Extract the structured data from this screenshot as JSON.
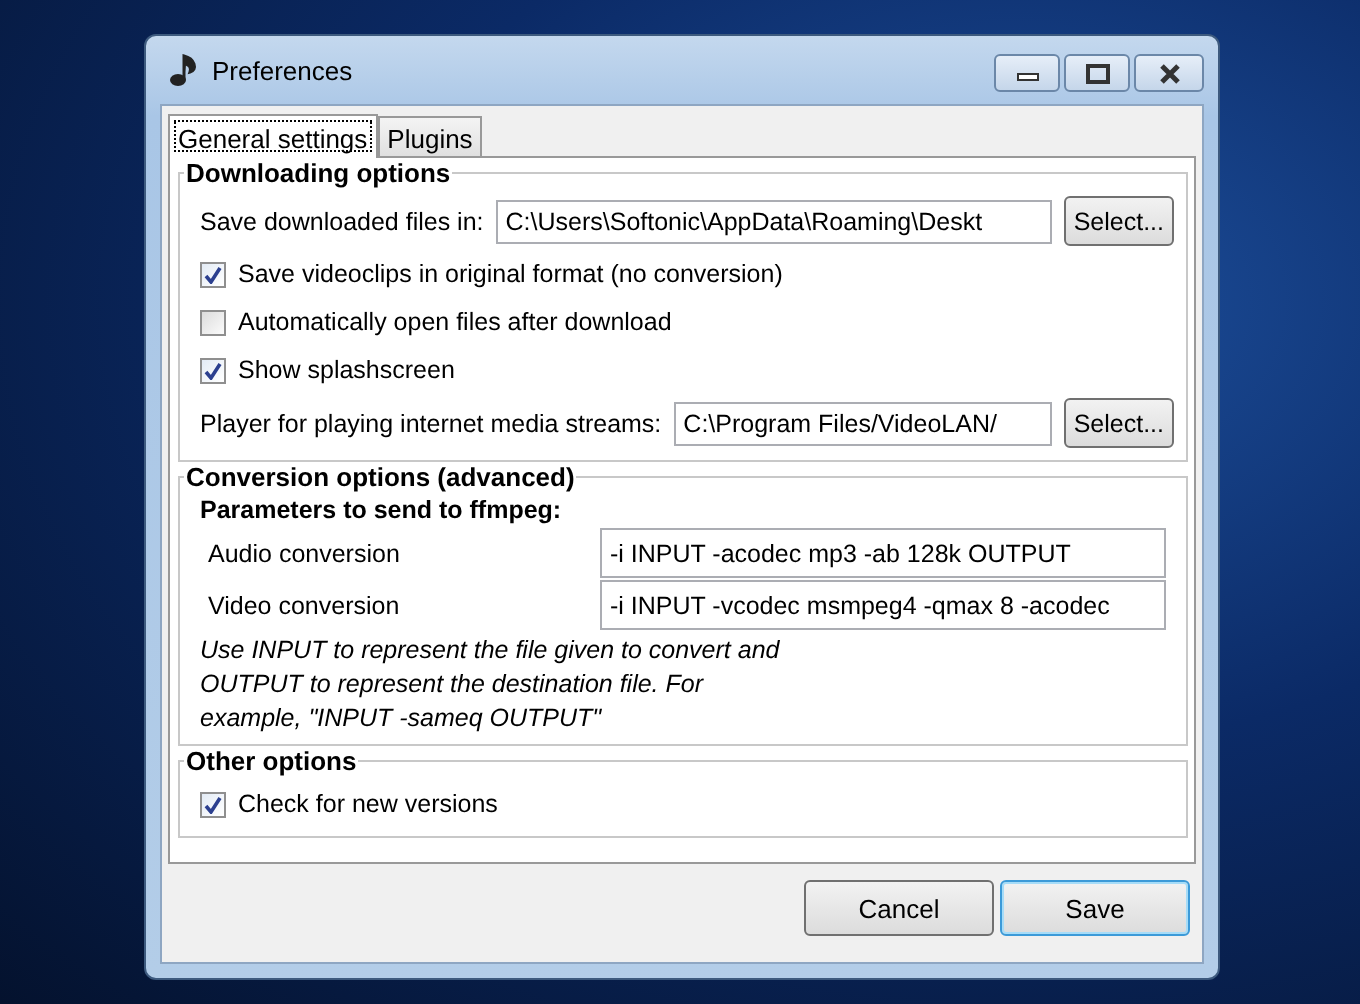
{
  "window": {
    "title": "Preferences"
  },
  "tabs": [
    {
      "label": "General settings",
      "selected": true
    },
    {
      "label": "Plugins",
      "selected": false
    }
  ],
  "downloading": {
    "title": "Downloading options",
    "rows": [
      {
        "kind": "path",
        "label": "Save downloaded files in:",
        "value": "C:\\Users\\Softonic\\AppData\\Roaming\\Deskt",
        "button": "Select..."
      },
      {
        "kind": "checkbox",
        "label": "Save videoclips in original format (no conversion)",
        "checked": true
      },
      {
        "kind": "checkbox",
        "label": "Automatically open files after download",
        "checked": false
      },
      {
        "kind": "checkbox",
        "label": "Show splashscreen",
        "checked": true
      },
      {
        "kind": "path",
        "label": "Player for playing internet media streams:",
        "value": "C:\\Program Files/VideoLAN/",
        "button": "Select..."
      }
    ]
  },
  "conversion": {
    "title": "Conversion options (advanced)",
    "subtitle": "Parameters to send to ffmpeg:",
    "fields": [
      {
        "label": "Audio conversion",
        "value": "-i INPUT -acodec mp3 -ab 128k OUTPUT"
      },
      {
        "label": "Video conversion",
        "value": "-i INPUT -vcodec msmpeg4 -qmax 8 -acodec"
      }
    ],
    "note": "Use INPUT to represent the file given to convert and OUTPUT to represent the destination file. For example, \"INPUT -sameq OUTPUT\""
  },
  "other": {
    "title": "Other options",
    "options": [
      {
        "label": "Check for new versions",
        "checked": true
      }
    ]
  },
  "buttons": [
    {
      "label": "Cancel",
      "default": false
    },
    {
      "label": "Save",
      "default": true
    }
  ]
}
